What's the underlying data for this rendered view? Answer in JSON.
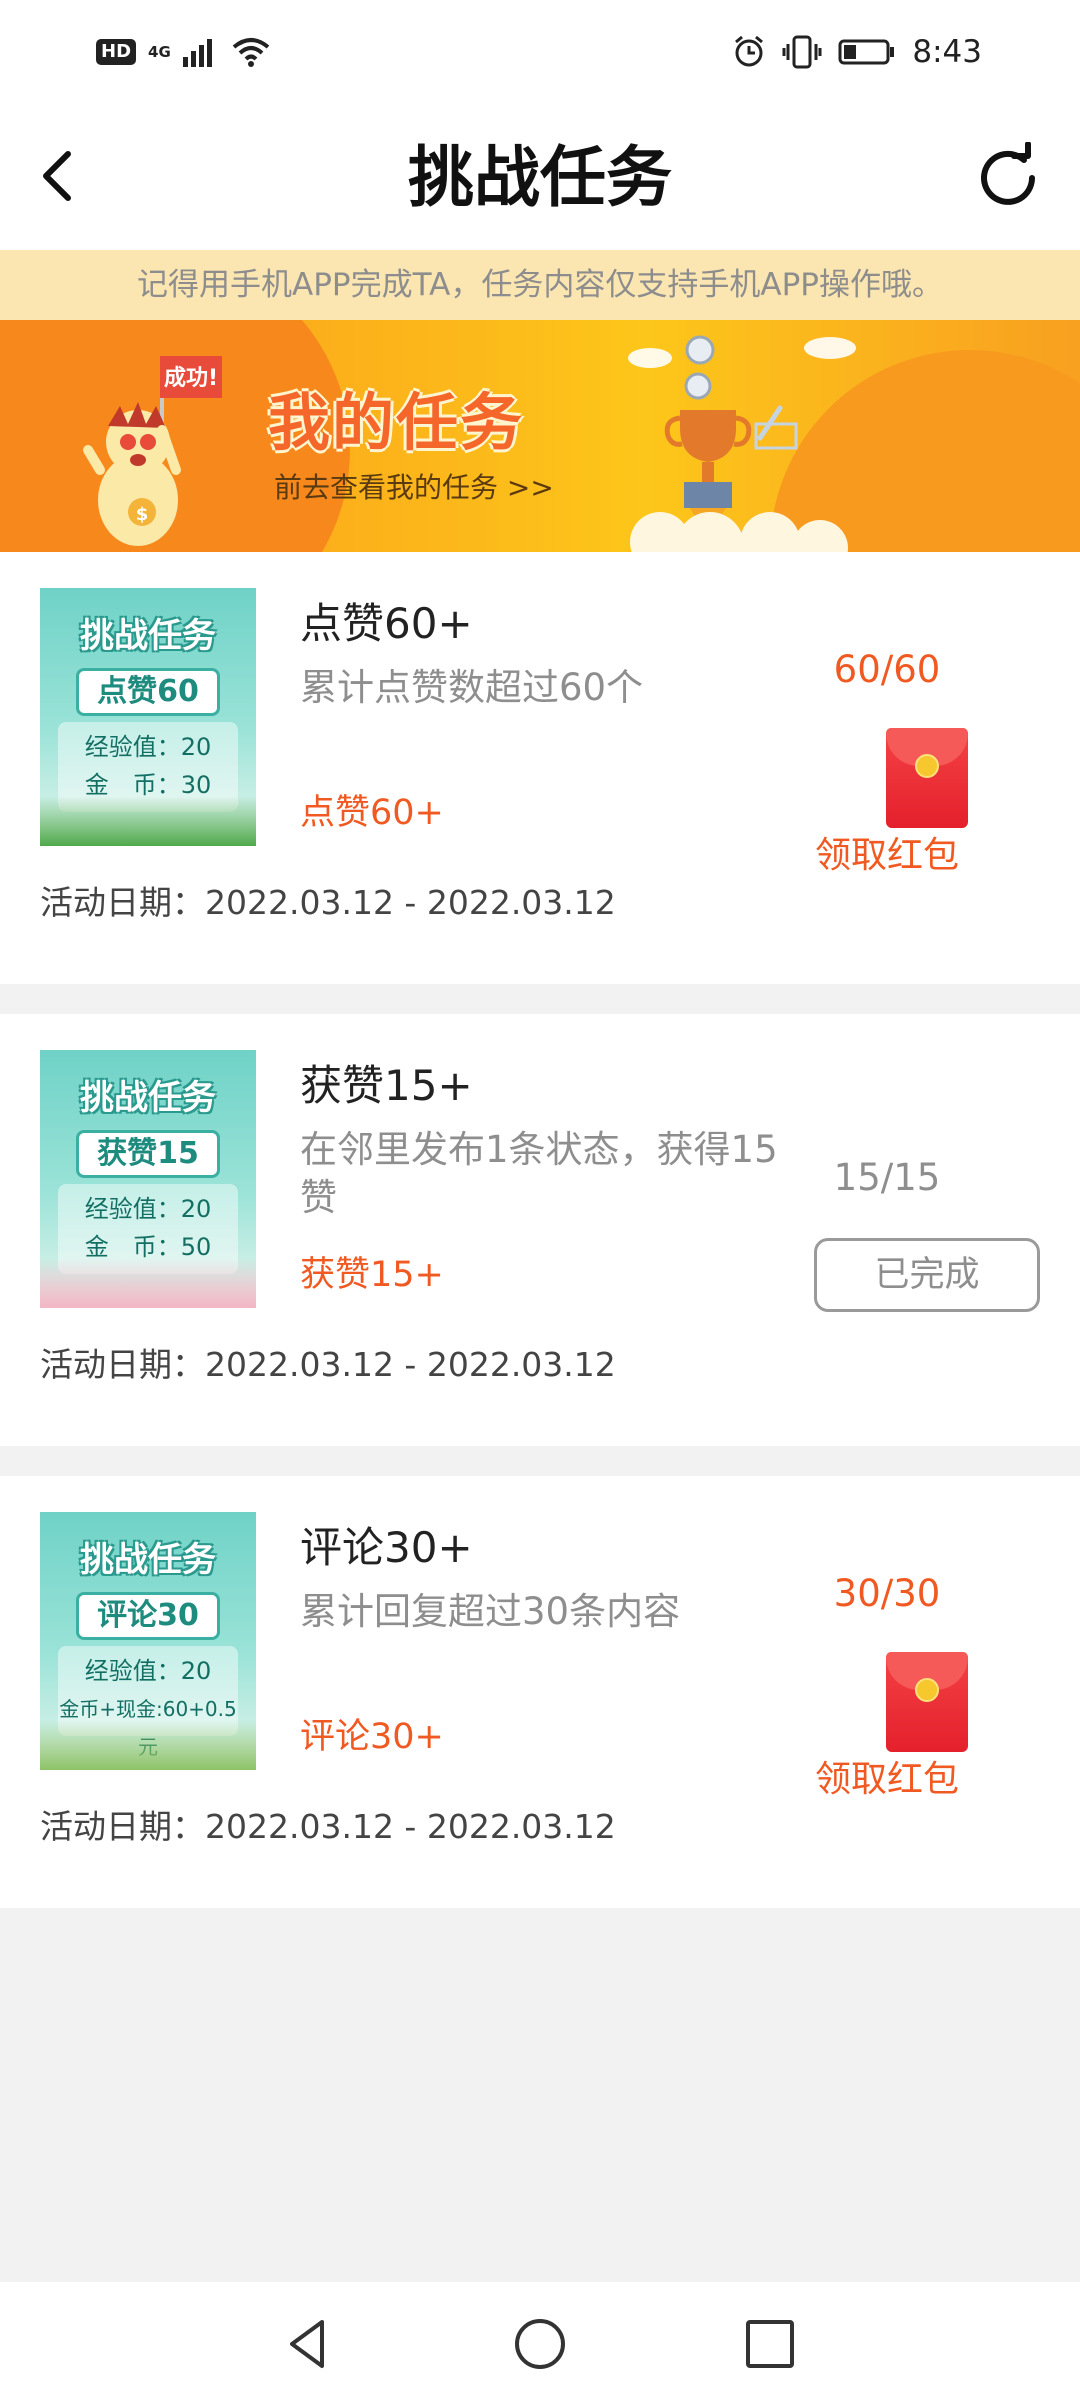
{
  "status_bar": {
    "left_badge": "HD",
    "network": "4G",
    "time": "8:43"
  },
  "header": {
    "title": "挑战任务",
    "back_icon": "chevron-left-icon",
    "refresh_icon": "refresh-icon"
  },
  "notice": {
    "text": "记得用手机APP完成TA，任务内容仅支持手机APP操作哦。"
  },
  "banner": {
    "flag_text": "成功!",
    "title": "我的任务",
    "link": "前去查看我的任务 >>"
  },
  "tasks": [
    {
      "thumb_title": "挑战任务",
      "thumb_name": "点赞60",
      "thumb_exp": "经验值：20",
      "thumb_coin": "金　币：30",
      "title": "点赞60+",
      "desc": "累计点赞数超过60个",
      "tag": "点赞60+",
      "date": "活动日期：2022.03.12 - 2022.03.12",
      "progress": "60/60",
      "action": "领取红包",
      "status": "claim"
    },
    {
      "thumb_title": "挑战任务",
      "thumb_name": "获赞15",
      "thumb_exp": "经验值：20",
      "thumb_coin": "金　币：50",
      "title": "获赞15+",
      "desc": "在邻里发布1条状态，获得15赞",
      "tag": "获赞15+",
      "date": "活动日期：2022.03.12 - 2022.03.12",
      "progress": "15/15",
      "action": "已完成",
      "status": "done"
    },
    {
      "thumb_title": "挑战任务",
      "thumb_name": "评论30",
      "thumb_exp": "经验值：20",
      "thumb_coin": "金币+现金:60+0.5元",
      "title": "评论30+",
      "desc": "累计回复超过30条内容",
      "tag": "评论30+",
      "date": "活动日期：2022.03.12 - 2022.03.12",
      "progress": "30/30",
      "action": "领取红包",
      "status": "claim"
    }
  ],
  "colors": {
    "accent": "#f05a22",
    "notice_bg": "#fbe6b2",
    "envelope": "#e4202c"
  },
  "nav_bar": {
    "back_icon": "triangle-back-icon",
    "home_icon": "circle-home-icon",
    "recents_icon": "square-recents-icon"
  }
}
